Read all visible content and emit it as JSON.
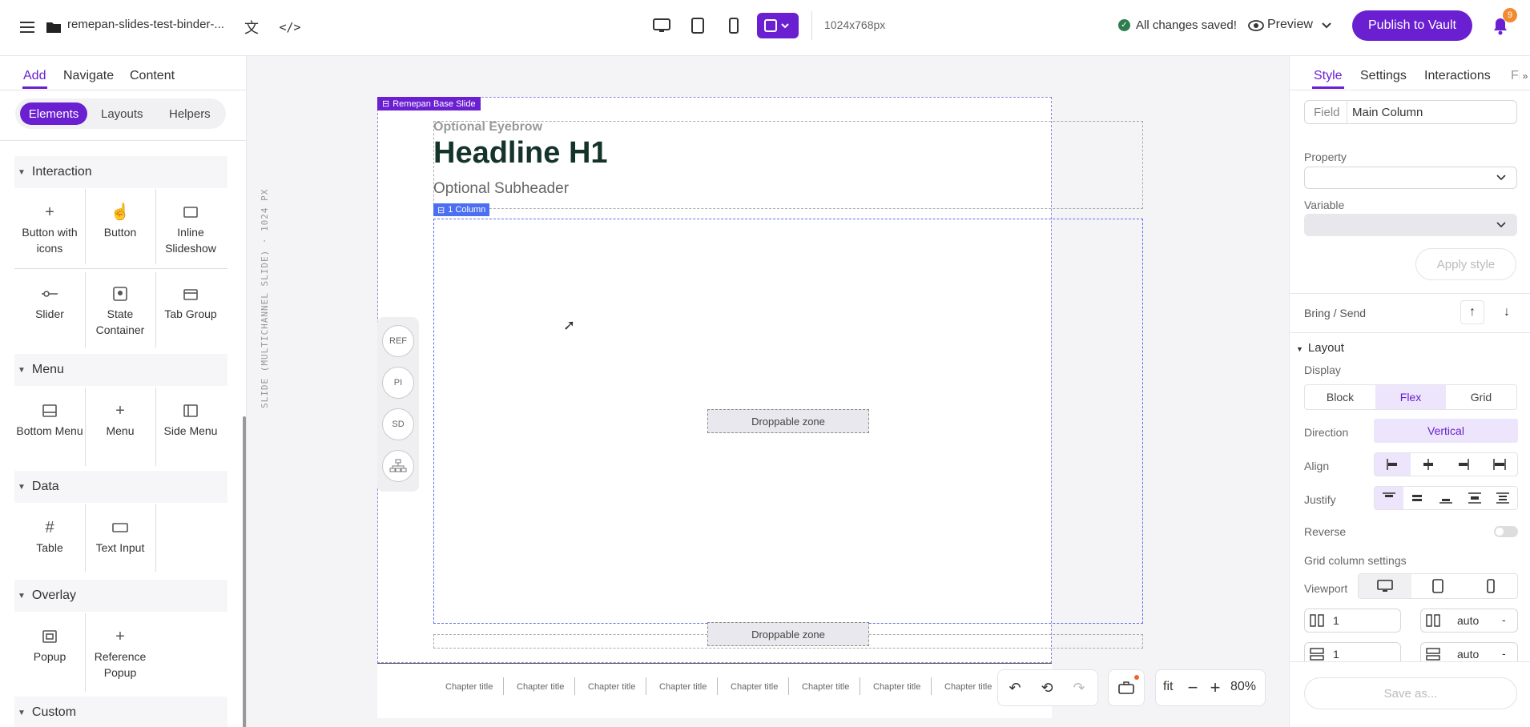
{
  "topbar": {
    "project_name": "remepan-slides-test-binder-...",
    "resolution": "1024x768px",
    "save_status": "All changes saved!",
    "preview_label": "Preview",
    "publish_label": "Publish to Vault",
    "notification_count": "9"
  },
  "left": {
    "tabs": [
      "Add",
      "Navigate",
      "Content"
    ],
    "subtabs": [
      "Elements",
      "Layouts",
      "Helpers"
    ],
    "sections": {
      "interaction": "Interaction",
      "menu": "Menu",
      "data": "Data",
      "overlay": "Overlay",
      "custom": "Custom"
    },
    "interaction_items": [
      "Button with icons",
      "Button",
      "Inline Slideshow",
      "Slider",
      "State Container",
      "Tab Group"
    ],
    "menu_items": [
      "Bottom Menu",
      "Menu",
      "Side Menu"
    ],
    "data_items": [
      "Table",
      "Text Input"
    ],
    "overlay_items": [
      "Popup",
      "Reference Popup"
    ]
  },
  "canvas": {
    "vertical_label": "SLIDE (MULTICHANNEL SLIDE) · 1024 PX",
    "base_slide_tag": "Remepan Base Slide",
    "eyebrow": "Optional Eyebrow",
    "headline": "Headline H1",
    "subheader": "Optional Subheader",
    "column_tag": "1 Column",
    "droppable_1": "Droppable zone",
    "droppable_2": "Droppable zone",
    "side_buttons": [
      "REF",
      "PI",
      "SD"
    ],
    "chapters": [
      "Chapter title",
      "Chapter title",
      "Chapter title",
      "Chapter title",
      "Chapter title",
      "Chapter title",
      "Chapter title",
      "Chapter title"
    ],
    "zoom_fit": "fit",
    "zoom_level": "80%"
  },
  "right": {
    "tabs": [
      "Style",
      "Settings",
      "Interactions",
      "Fi"
    ],
    "field_label": "Field",
    "field_value": "Main Column",
    "property_label": "Property",
    "variable_label": "Variable",
    "apply_style": "Apply style",
    "bring_send": "Bring / Send",
    "layout_header": "Layout",
    "display_label": "Display",
    "display_options": [
      "Block",
      "Flex",
      "Grid"
    ],
    "direction_label": "Direction",
    "direction_value": "Vertical",
    "align_label": "Align",
    "justify_label": "Justify",
    "reverse_label": "Reverse",
    "grid_settings_label": "Grid column settings",
    "viewport_label": "Viewport",
    "col_value": "1",
    "col_auto": "auto",
    "row_value": "1",
    "row_auto": "auto",
    "save_as": "Save as..."
  },
  "colors": {
    "accent": "#6a1fd1",
    "blue": "#4b6ff0",
    "saved_green": "#2e7d4f"
  }
}
